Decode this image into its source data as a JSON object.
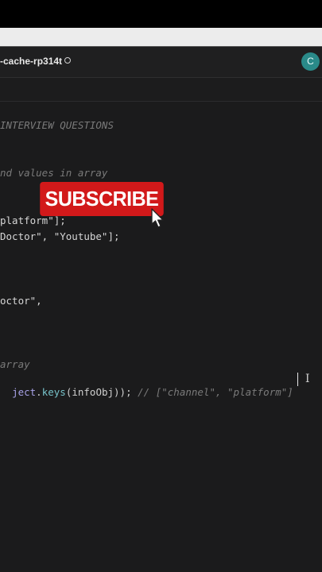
{
  "browser": {
    "top_band": "",
    "address_bar": ""
  },
  "header": {
    "project_name": "-cache-rp314t",
    "avatar_initial": "C",
    "avatar_color": "#2a8a89"
  },
  "editor": {
    "line_title": "INTERVIEW QUESTIONS",
    "line_subtitle": "nd values in array",
    "line_arr1": "platform\"];",
    "line_arr2": "Doctor\", \"Youtube\"];",
    "line_obj": "octor\",",
    "line_array": "array",
    "line_code_object": "ject",
    "line_code_dot": ".",
    "line_code_keys": "keys",
    "line_code_args": "(infoObj));",
    "line_code_comment": "// [\"channel\", \"platform\"]"
  },
  "overlay": {
    "subscribe_label": "SUBSCRIBE",
    "subscribe_color": "#d2191a"
  },
  "icons": [
    "globe-icon",
    "mouse-pointer-icon",
    "text-cursor-icon"
  ]
}
